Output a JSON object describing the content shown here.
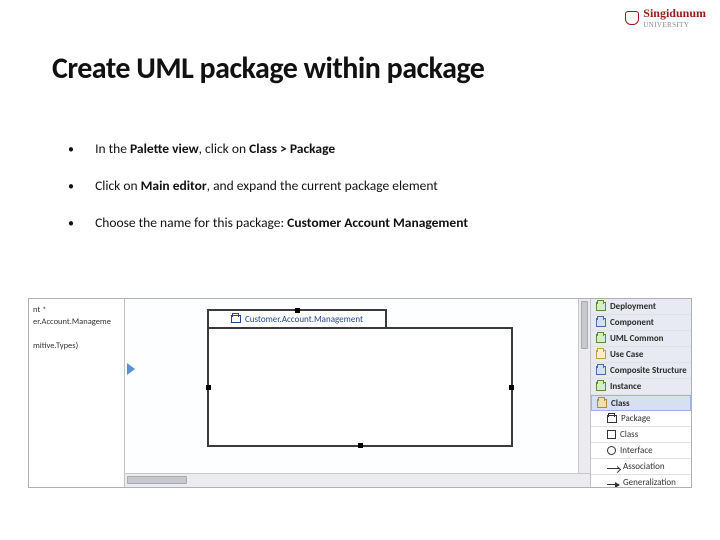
{
  "brand": {
    "name": "Singidunum",
    "sub": "UNIVERSITY"
  },
  "title": "Create UML package within package",
  "bullets": [
    {
      "pre": "In the ",
      "b1": "Palette view",
      "mid": ", click on ",
      "b2": "Class > Package",
      "post": ""
    },
    {
      "pre": "Click on ",
      "b1": "Main editor",
      "mid": ", and expand the current package element",
      "b2": "",
      "post": ""
    },
    {
      "pre": "Choose the name for this package: ",
      "b1": "Customer Account Management",
      "mid": "",
      "b2": "",
      "post": ""
    }
  ],
  "proj": {
    "l1": "nt *",
    "l2": "er.Account.Manageme",
    "l3": "mitive.Types)"
  },
  "package_name": "Customer.Account.Management",
  "palette": {
    "drawers": [
      {
        "label": "Deployment",
        "cls": "gr"
      },
      {
        "label": "Component",
        "cls": "bl"
      },
      {
        "label": "UML Common",
        "cls": "gr"
      },
      {
        "label": "Use Case",
        "cls": "yl"
      },
      {
        "label": "Composite Structure",
        "cls": "bl"
      },
      {
        "label": "Instance",
        "cls": "gr"
      }
    ],
    "class_drawer": "Class",
    "items": [
      {
        "label": "Package",
        "icon": "ic-pkg"
      },
      {
        "label": "Class",
        "icon": "ic-class"
      },
      {
        "label": "Interface",
        "icon": "ic-if"
      },
      {
        "label": "Association",
        "icon": "ic-assoc"
      },
      {
        "label": "Generalization",
        "icon": "ic-gen"
      }
    ]
  }
}
